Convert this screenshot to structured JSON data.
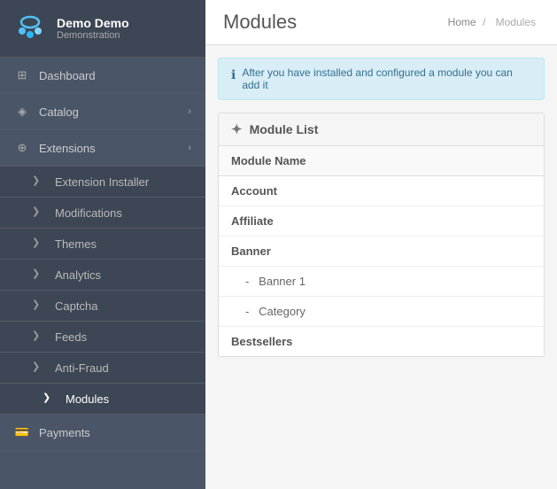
{
  "sidebar": {
    "brand": {
      "name": "Demo Demo",
      "sub": "Demonstration"
    },
    "nav": [
      {
        "id": "dashboard",
        "label": "Dashboard",
        "icon": "🏠",
        "type": "item"
      },
      {
        "id": "catalog",
        "label": "Catalog",
        "icon": "📦",
        "type": "item",
        "arrow": "›"
      },
      {
        "id": "extensions",
        "label": "Extensions",
        "icon": "🔌",
        "type": "item",
        "expanded": true,
        "arrow": "›"
      }
    ],
    "subnav": [
      {
        "id": "extension-installer",
        "label": "Extension Installer",
        "icon": "❯"
      },
      {
        "id": "modifications",
        "label": "Modifications",
        "icon": "❯"
      },
      {
        "id": "themes",
        "label": "Themes",
        "icon": "❯"
      },
      {
        "id": "analytics",
        "label": "Analytics",
        "icon": "❯"
      },
      {
        "id": "captcha",
        "label": "Captcha",
        "icon": "❯"
      },
      {
        "id": "feeds",
        "label": "Feeds",
        "icon": "❯"
      },
      {
        "id": "anti-fraud",
        "label": "Anti-Fraud",
        "icon": "❯"
      },
      {
        "id": "modules",
        "label": "Modules",
        "icon": "❯",
        "active": true
      }
    ],
    "bottom_nav": [
      {
        "id": "payments",
        "label": "Payments",
        "icon": "💳",
        "type": "item"
      }
    ]
  },
  "main": {
    "title": "Modules",
    "breadcrumb": {
      "home": "Home",
      "separator": "/",
      "current": "Modules"
    },
    "info_message": "After you have installed and configured a module you can add it",
    "module_list": {
      "header": "Module List",
      "columns": [
        {
          "key": "module_name",
          "label": "Module Name"
        }
      ],
      "rows": [
        {
          "type": "group",
          "name": "Account",
          "indent": false
        },
        {
          "type": "group",
          "name": "Affiliate",
          "indent": false
        },
        {
          "type": "group",
          "name": "Banner",
          "indent": false
        },
        {
          "type": "sub",
          "name": "Banner 1",
          "indent": true
        },
        {
          "type": "sub",
          "name": "Category",
          "indent": true
        },
        {
          "type": "group",
          "name": "Bestsellers",
          "indent": false
        }
      ]
    }
  }
}
